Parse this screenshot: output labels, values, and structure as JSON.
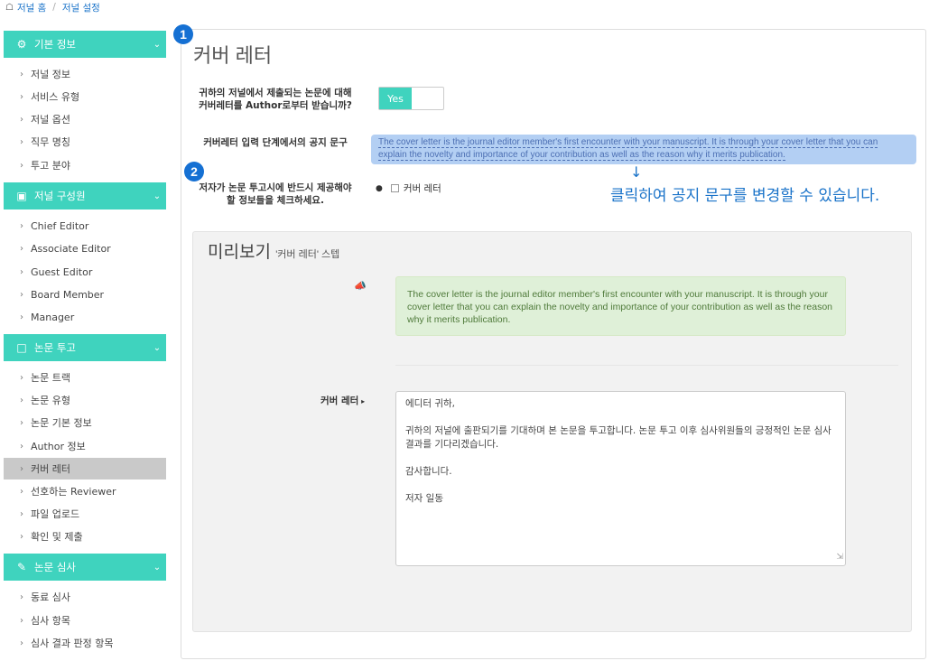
{
  "breadcrumb": {
    "home": "저널 홈",
    "current": "저널 설정"
  },
  "sidebar": {
    "sections": [
      {
        "label": "기본 정보",
        "icon": "gear-icon",
        "items": [
          "저널 정보",
          "서비스 유형",
          "저널 옵션",
          "직무 명칭",
          "투고 분야"
        ]
      },
      {
        "label": "저널 구성원",
        "icon": "briefcase-icon",
        "items": [
          "Chief Editor",
          "Associate Editor",
          "Guest Editor",
          "Board Member",
          "Manager"
        ]
      },
      {
        "label": "논문 투고",
        "icon": "document-icon",
        "items": [
          "논문 트랙",
          "논문 유형",
          "논문 기본 정보",
          "Author 정보",
          "커버 레터",
          "선호하는 Reviewer",
          "파일 업로드",
          "확인 및 제출"
        ]
      },
      {
        "label": "논문 심사",
        "icon": "edit-icon",
        "items": [
          "동료 심사",
          "심사 항목",
          "심사 결과 판정 항목"
        ]
      }
    ],
    "active_item": "커버 레터"
  },
  "badges": {
    "one": "1",
    "two": "2"
  },
  "main": {
    "title": "커버 레터",
    "q1_label_line1": "귀하의 저널에서 제출되는 논문에 대해",
    "q1_label_line2": "커버레터를 Author로부터 받습니까?",
    "toggle_on": "Yes",
    "notice_label": "커버레터 입력 단계에서의 공지 문구",
    "notice_text_line1": "The cover letter is the journal editor member's first encounter with your manuscript. It is through your cover letter that you can",
    "notice_text_line2": "explain the novelty and importance of your contribution as well as the reason why it merits publication.",
    "hint": "클릭하여 공지 문구를 변경할 수 있습니다.",
    "q3_label_line1": "저자가 논문 투고시에 반드시 제공해야",
    "q3_label_line2": "할 정보들을 체크하세요.",
    "checkbox_label": "커버 레터"
  },
  "preview": {
    "title": "미리보기",
    "subtitle": "'커버 레터' 스텝",
    "notice_text": "The cover letter is the journal editor member's first encounter with your manuscript. It is through your cover letter that you can explain the novelty and importance of your contribution as well as the reason why it merits publication.",
    "cover_letter_label": "커버 레터",
    "letter_greeting": "에디터 귀하,",
    "letter_body": "귀하의 저널에 출판되기를 기대하며 본 논문을 투고합니다. 논문 투고 이후 심사위원들의 긍정적인 논문 심사 결과를 기다리겠습니다.",
    "letter_thanks": "감사합니다.",
    "letter_sign": "저자 일동"
  },
  "colors": {
    "accent": "#3fd3be",
    "link": "#1a73c9",
    "badge": "#1570d3",
    "notice_bg": "#dff0d8",
    "editable_bg": "#b3cff3"
  }
}
